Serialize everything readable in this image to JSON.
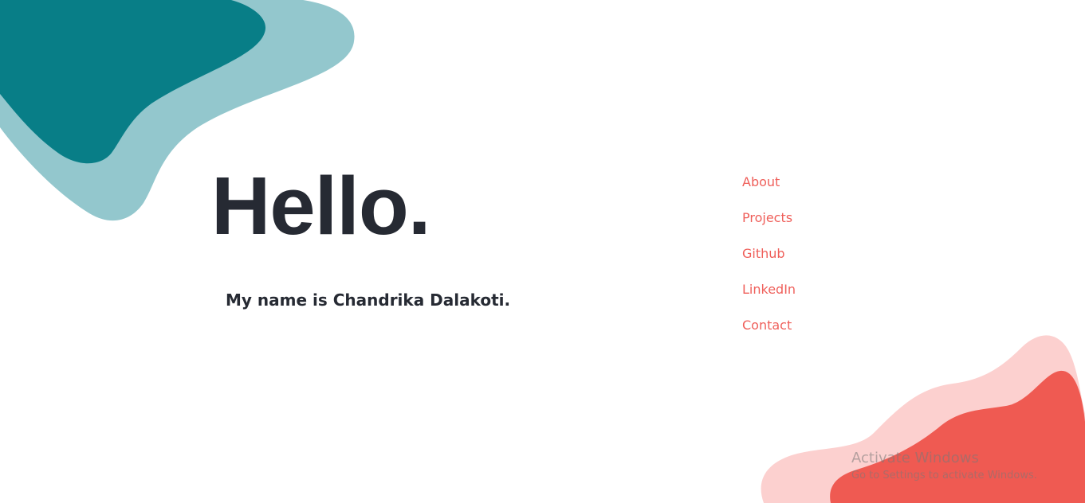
{
  "hero": {
    "title": "Hello.",
    "subtitle": "My name is Chandrika Dalakoti."
  },
  "nav": {
    "items": [
      {
        "label": "About"
      },
      {
        "label": "Projects"
      },
      {
        "label": "Github"
      },
      {
        "label": "LinkedIn"
      },
      {
        "label": "Contact"
      }
    ]
  },
  "watermark": {
    "title": "Activate Windows",
    "subtitle": "Go to Settings to activate Windows."
  },
  "colors": {
    "teal_dark": "#087e87",
    "teal_light": "#93c7cd",
    "coral": "#ef5a52",
    "coral_light": "#fcd0cf",
    "text_dark": "#262a33",
    "link": "#ef5f5a"
  }
}
